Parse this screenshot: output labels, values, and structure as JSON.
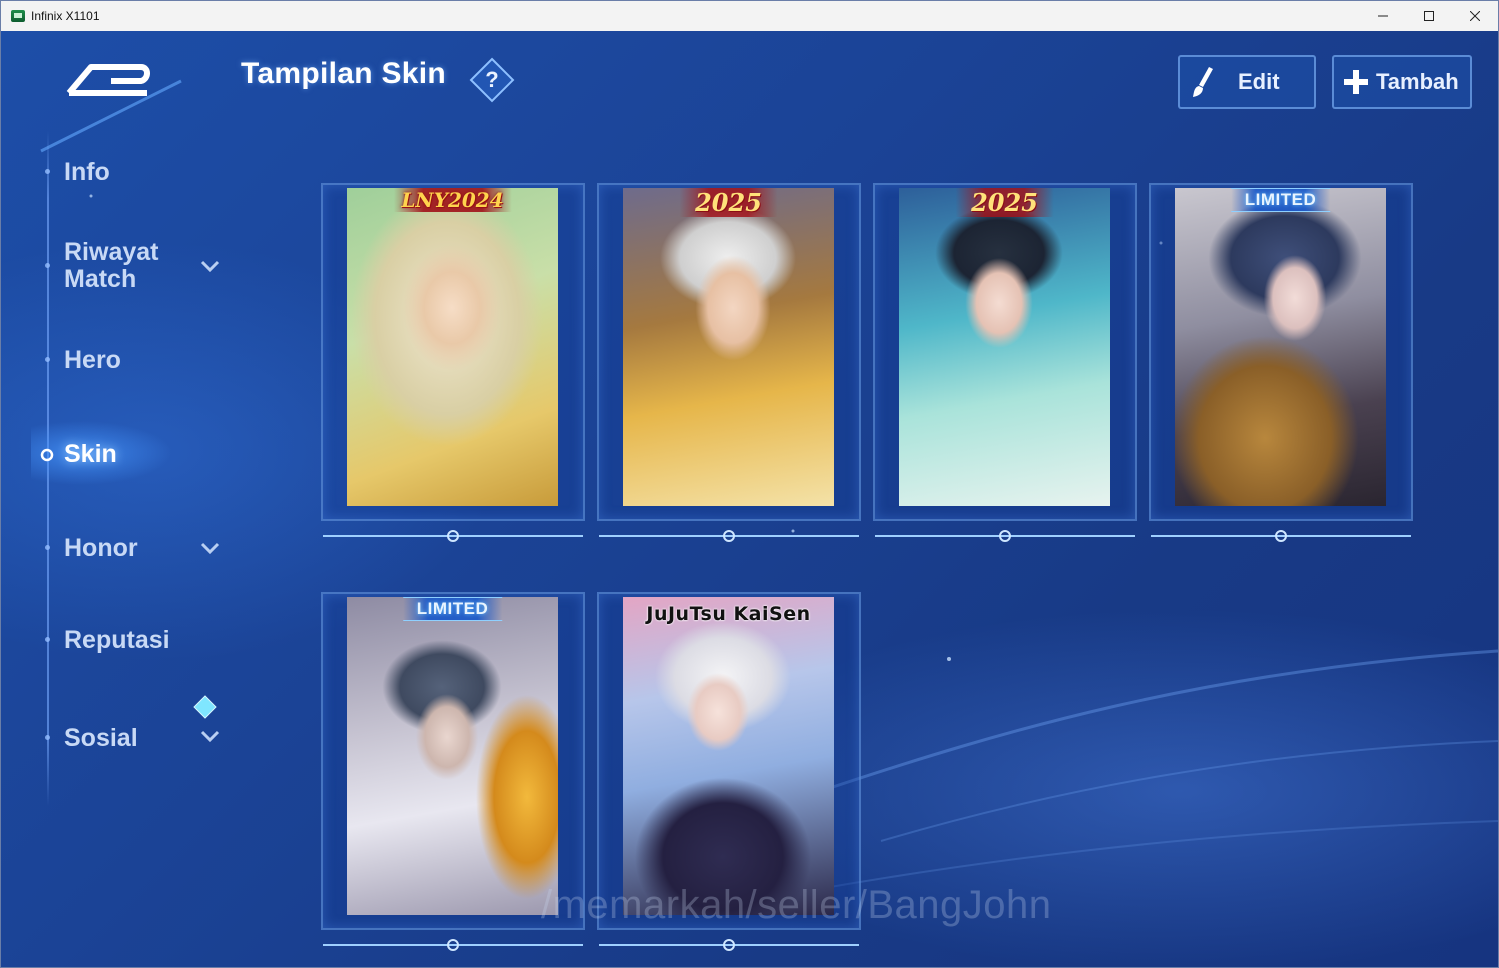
{
  "window": {
    "title": "Infinix X1101",
    "controls": {
      "minimize_icon": "minimize-icon",
      "maximize_icon": "maximize-icon",
      "close_icon": "close-icon"
    }
  },
  "header": {
    "title": "Tampilan Skin",
    "help_label": "?",
    "edit_label": "Edit",
    "add_label": "Tambah"
  },
  "sidebar": {
    "items": [
      {
        "label": "Info",
        "has_chevron": false
      },
      {
        "label": "Riwayat\nMatch",
        "has_chevron": true
      },
      {
        "label": "Hero",
        "has_chevron": false
      },
      {
        "label": "Skin",
        "has_chevron": false,
        "active": true
      },
      {
        "label": "Honor",
        "has_chevron": true
      },
      {
        "label": "Reputasi",
        "has_chevron": false
      },
      {
        "label": "Sosial",
        "has_chevron": true,
        "has_notification": true
      }
    ]
  },
  "skins": [
    {
      "badge": "LNY2024",
      "badge_style": "lny"
    },
    {
      "badge": "2025",
      "badge_style": "yr"
    },
    {
      "badge": "2025",
      "badge_style": "yr"
    },
    {
      "badge": "LIMITED",
      "badge_style": "ltd"
    },
    {
      "badge": "LIMITED",
      "badge_style": "ltd"
    },
    {
      "badge": "JuJuTsu KaiSen",
      "badge_style": "jjk"
    }
  ],
  "watermark": "/memarkah/seller/BangJohn",
  "colors": {
    "background": "#1b4396",
    "accent": "#5aa0ff",
    "text_primary": "#ffffff",
    "text_secondary": "#c8d9f5"
  }
}
